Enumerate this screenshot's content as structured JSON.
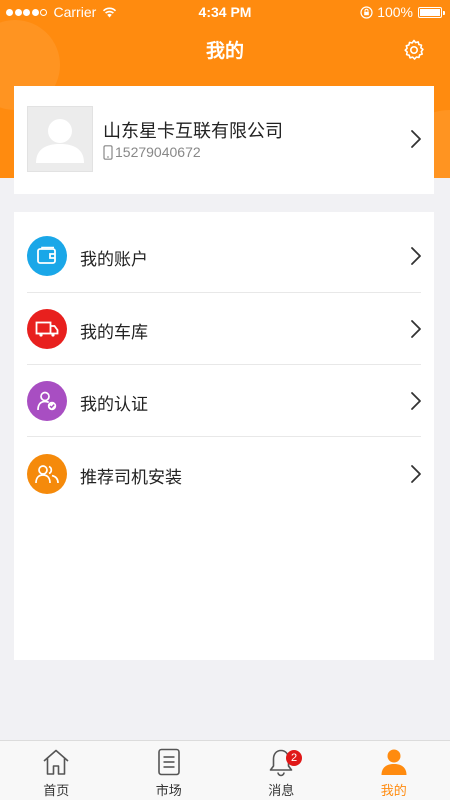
{
  "status_bar": {
    "carrier": "Carrier",
    "time": "4:34 PM",
    "battery": "100%"
  },
  "nav": {
    "title": "我的",
    "settings_icon": "gear-icon"
  },
  "profile": {
    "company_name": "山东星卡互联有限公司",
    "phone": "15279040672",
    "avatar_icon": "default-avatar-icon"
  },
  "menu": {
    "items": [
      {
        "label": "我的账户",
        "icon": "wallet-icon",
        "color": "#1aa7e8"
      },
      {
        "label": "我的车库",
        "icon": "truck-icon",
        "color": "#e8201e"
      },
      {
        "label": "我的认证",
        "icon": "verified-user-icon",
        "color": "#a84ec2"
      },
      {
        "label": "推荐司机安装",
        "icon": "users-icon",
        "color": "#f58a0b"
      }
    ]
  },
  "tabs": [
    {
      "label": "首页",
      "icon": "home-icon"
    },
    {
      "label": "市场",
      "icon": "market-list-icon"
    },
    {
      "label": "消息",
      "icon": "bell-icon",
      "badge": "2"
    },
    {
      "label": "我的",
      "icon": "user-icon",
      "active": true
    }
  ],
  "colors": {
    "accent": "#ff8b0f",
    "background": "#f1f1f4",
    "badge": "#e01818"
  }
}
